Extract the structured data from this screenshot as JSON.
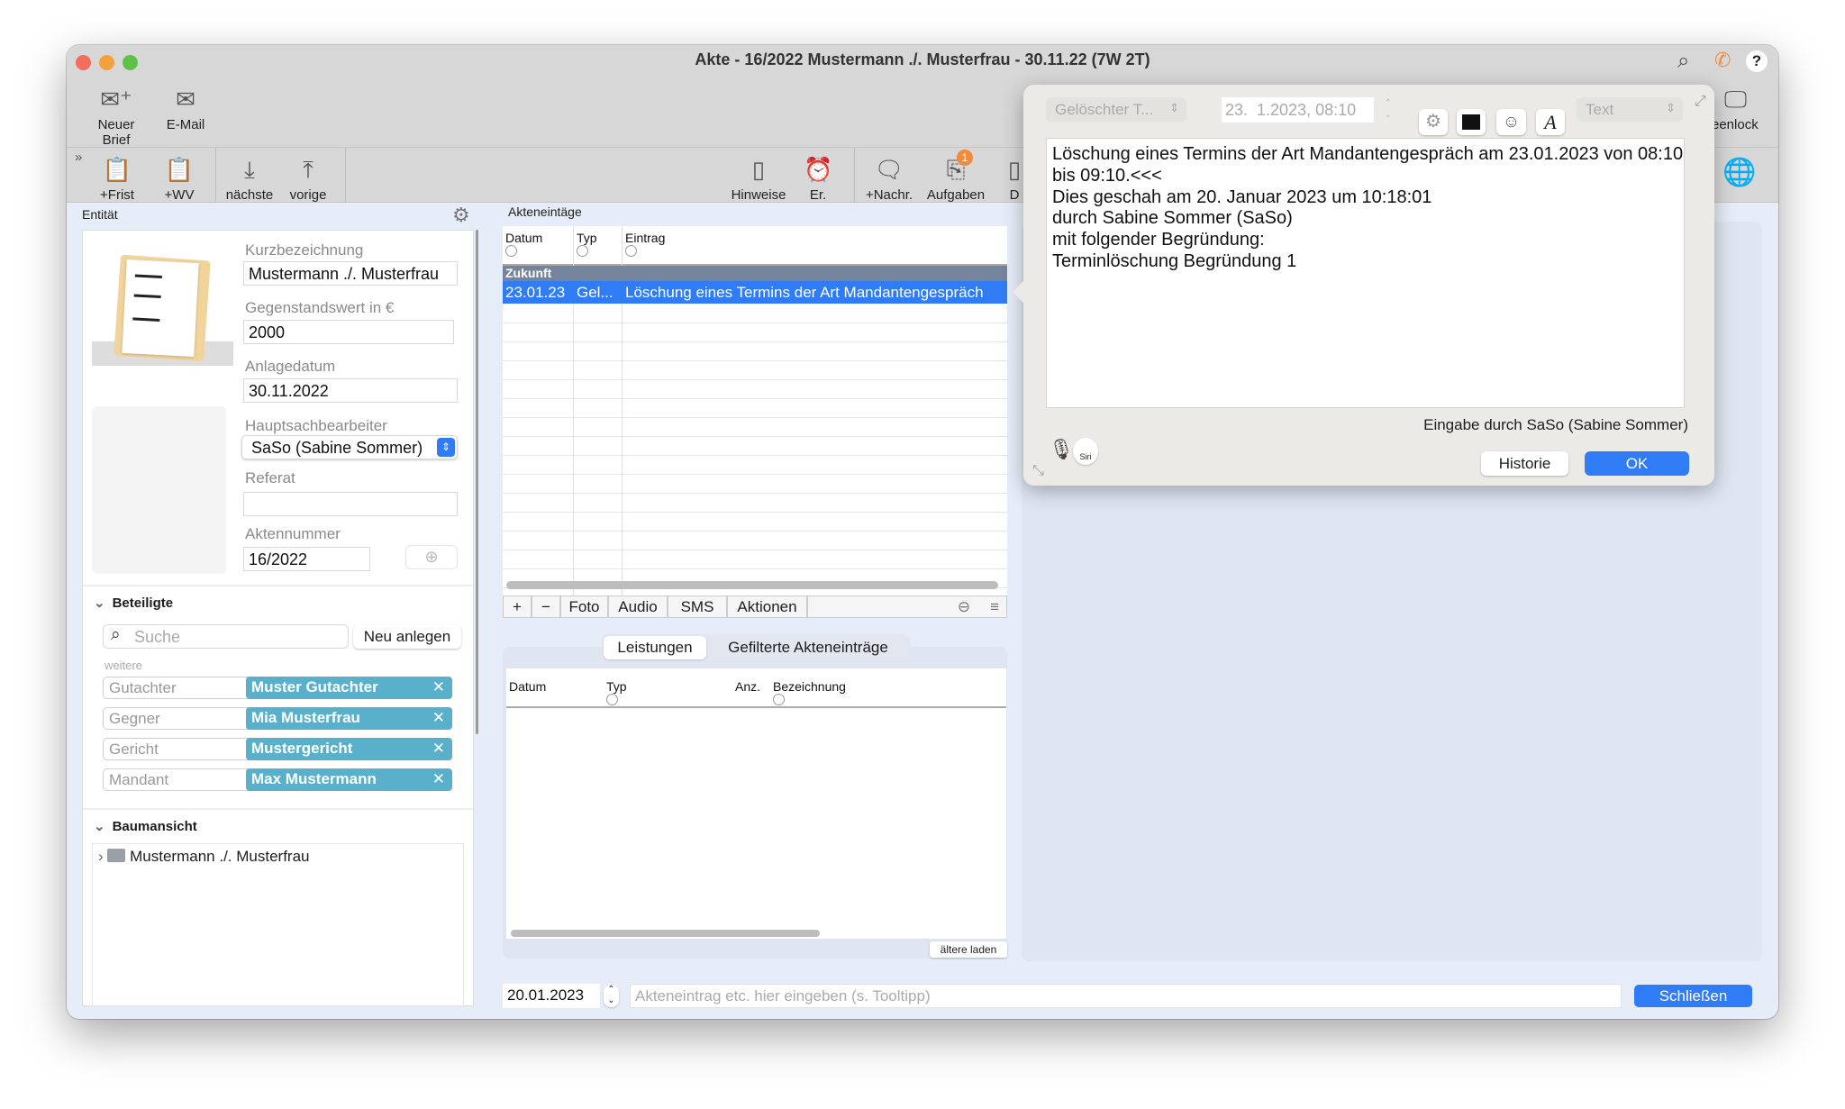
{
  "window": {
    "title": "Akte - 16/2022 Mustermann ./. Musterfrau - 30.11.22 (7W 2T)"
  },
  "toolbar": {
    "row1": [
      {
        "label": "Neuer Brief",
        "icon": "new-letter-icon"
      },
      {
        "label": "E-Mail",
        "icon": "envelope-icon"
      }
    ],
    "row2": [
      {
        "label": "+Frist",
        "icon": "clipboard-deadline-icon"
      },
      {
        "label": "+WV",
        "icon": "clipboard-resubmission-icon"
      },
      {
        "label": "nächste",
        "icon": "arrow-down-icon"
      },
      {
        "label": "vorige",
        "icon": "arrow-up-icon"
      },
      {
        "label": "Hinweise",
        "icon": "clipboard-icon"
      },
      {
        "label": "Er.",
        "icon": "alarm-clock-icon"
      },
      {
        "label": "+Nachr.",
        "icon": "message-icon"
      },
      {
        "label": "Aufgaben",
        "icon": "tasks-icon",
        "badge": "1"
      },
      {
        "label": "D",
        "icon": "document-icon"
      }
    ],
    "screenlock": "eenlock",
    "badge_color": "#f08a3c"
  },
  "entity": {
    "header": "Entität",
    "fields": {
      "kurz_label": "Kurzbezeichnung",
      "kurz_value": "Mustermann ./. Musterfrau",
      "gegen_label": "Gegenstandswert in €",
      "gegen_value": "2000",
      "anlage_label": "Anlagedatum",
      "anlage_value": "30.11.2022",
      "haupt_label": "Hauptsachbearbeiter",
      "haupt_value": "SaSo (Sabine Sommer)",
      "referat_label": "Referat",
      "referat_value": "",
      "akten_label": "Aktennummer",
      "akten_value": "16/2022"
    }
  },
  "beteiligte": {
    "header": "Beteiligte",
    "search_placeholder": "Suche",
    "new_button": "Neu anlegen",
    "more_label": "weitere",
    "rows": [
      {
        "role": "Gutachter",
        "name": "Muster Gutachter"
      },
      {
        "role": "Gegner",
        "name": "Mia Musterfrau"
      },
      {
        "role": "Gericht",
        "name": "Mustergericht"
      },
      {
        "role": "Mandant",
        "name": "Max Mustermann"
      }
    ],
    "chip_color": "#58b0cb"
  },
  "tree": {
    "header": "Baumansicht",
    "items": [
      {
        "label": "Mustermann ./. Musterfrau"
      }
    ]
  },
  "entries": {
    "header": "Akteneintäge",
    "columns": [
      "Datum",
      "Typ",
      "Eintrag"
    ],
    "group": "Zukunft",
    "rows": [
      {
        "datum": "23.01.23",
        "typ": "Gel...",
        "eintrag": "Löschung eines Termins der Art Mandantengespräch",
        "selected": true
      }
    ],
    "buttons": [
      "+",
      "−",
      "Foto",
      "Audio",
      "SMS",
      "Aktionen"
    ],
    "selected_color": "#2f7cf6"
  },
  "lower": {
    "tabs": [
      {
        "label": "Leistungen",
        "active": true
      },
      {
        "label": "Gefilterte Akteneinträge",
        "active": false
      }
    ],
    "columns": [
      "Datum",
      "Typ",
      "Anz.",
      "Bezeichnung"
    ],
    "load_older": "ältere laden"
  },
  "footer": {
    "date": "20.01.2023",
    "input_placeholder": "Akteneintrag etc. hier eingeben (s. Tooltipp)",
    "close_button": "Schließen"
  },
  "popover": {
    "type_select": "Gelöschter T...",
    "datetime": "23.  1.2023, 08:10",
    "format_select": "Text",
    "text_lines": [
      "Löschung eines Termins der Art Mandantengespräch am 23.01.2023 von 08:10",
      "bis 09:10.<<<",
      "Dies geschah am 20. Januar 2023 um 10:18:01",
      "durch Sabine Sommer (SaSo)",
      "mit folgender Begründung:",
      "Terminlöschung Begründung 1"
    ],
    "author": "Eingabe durch SaSo (Sabine Sommer)",
    "history_button": "Historie",
    "ok_button": "OK",
    "siri_label": "Siri"
  }
}
